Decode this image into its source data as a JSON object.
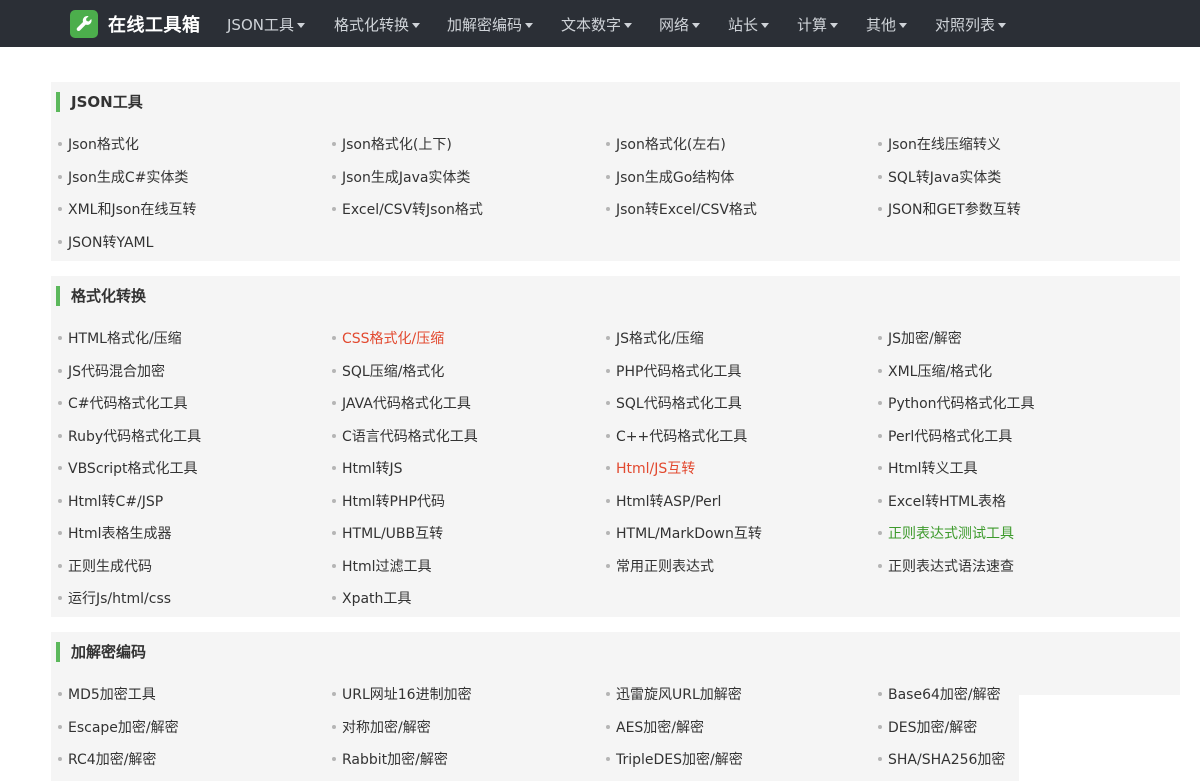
{
  "brand": {
    "name": "在线工具箱",
    "icon": "wrench-icon"
  },
  "nav": [
    "JSON工具",
    "格式化转换",
    "加解密编码",
    "文本数字",
    "网络",
    "站长",
    "计算",
    "其他",
    "对照列表"
  ],
  "colors": {
    "navbar_bg": "#2b2f36",
    "accent_green": "#5cb85c",
    "highlight_red": "#e2492f",
    "highlight_green": "#3d9a2c",
    "panel_bg": "#f5f5f5"
  },
  "sections": [
    {
      "title": "JSON工具",
      "tools": [
        "Json格式化",
        "Json格式化(上下)",
        "Json格式化(左右)",
        "Json在线压缩转义",
        "Json生成C#实体类",
        "Json生成Java实体类",
        "Json生成Go结构体",
        "SQL转Java实体类",
        "XML和Json在线互转",
        "Excel/CSV转Json格式",
        "Json转Excel/CSV格式",
        "JSON和GET参数互转",
        "JSON转YAML"
      ]
    },
    {
      "title": "格式化转换",
      "tools": [
        "HTML格式化/压缩",
        "CSS格式化/压缩",
        "JS格式化/压缩",
        "JS加密/解密",
        "JS代码混合加密",
        "SQL压缩/格式化",
        "PHP代码格式化工具",
        "XML压缩/格式化",
        "C#代码格式化工具",
        "JAVA代码格式化工具",
        "SQL代码格式化工具",
        "Python代码格式化工具",
        "Ruby代码格式化工具",
        "C语言代码格式化工具",
        "C++代码格式化工具",
        "Perl代码格式化工具",
        "VBScript格式化工具",
        "Html转JS",
        "Html/JS互转",
        "Html转义工具",
        "Html转C#/JSP",
        "Html转PHP代码",
        "Html转ASP/Perl",
        "Excel转HTML表格",
        "Html表格生成器",
        "HTML/UBB互转",
        "HTML/MarkDown互转",
        "正则表达式测试工具",
        "正则生成代码",
        "Html过滤工具",
        "常用正则表达式",
        "正则表达式语法速查",
        "运行Js/html/css",
        "Xpath工具"
      ],
      "highlight_red": [
        "CSS格式化/压缩",
        "Html/JS互转"
      ],
      "highlight_green": [
        "正则表达式测试工具"
      ]
    },
    {
      "title": "加解密编码",
      "tools": [
        "MD5加密工具",
        "URL网址16进制加密",
        "迅雷旋风URL加解密",
        "Base64加密/解密",
        "Escape加密/解密",
        "对称加密/解密",
        "AES加密/解密",
        "DES加密/解密",
        "RC4加密/解密",
        "Rabbit加密/解密",
        "TripleDES加密/解密",
        "SHA/SHA256加密"
      ]
    }
  ]
}
